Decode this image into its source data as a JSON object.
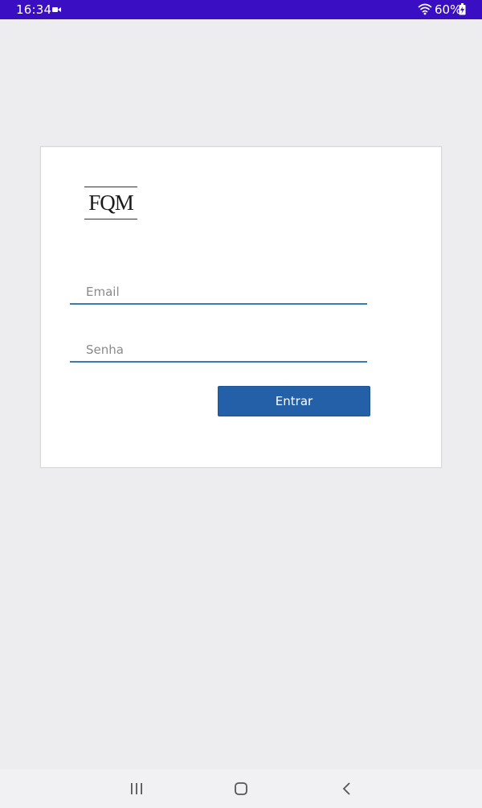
{
  "status_bar": {
    "time": "16:34",
    "battery_percent": "60%",
    "icons": [
      "video-camera-icon",
      "wifi-icon",
      "battery-charging-icon"
    ]
  },
  "login": {
    "logo_text": "FQM",
    "email_placeholder": "Email",
    "password_placeholder": "Senha",
    "submit_label": "Entrar"
  },
  "nav_bar": {
    "icons": [
      "recent-apps-icon",
      "home-icon",
      "back-icon"
    ]
  },
  "colors": {
    "status_bar": "#3a0fc4",
    "background": "#edecee",
    "accent": "#2360a8",
    "field_underline": "#3a7ab8"
  }
}
